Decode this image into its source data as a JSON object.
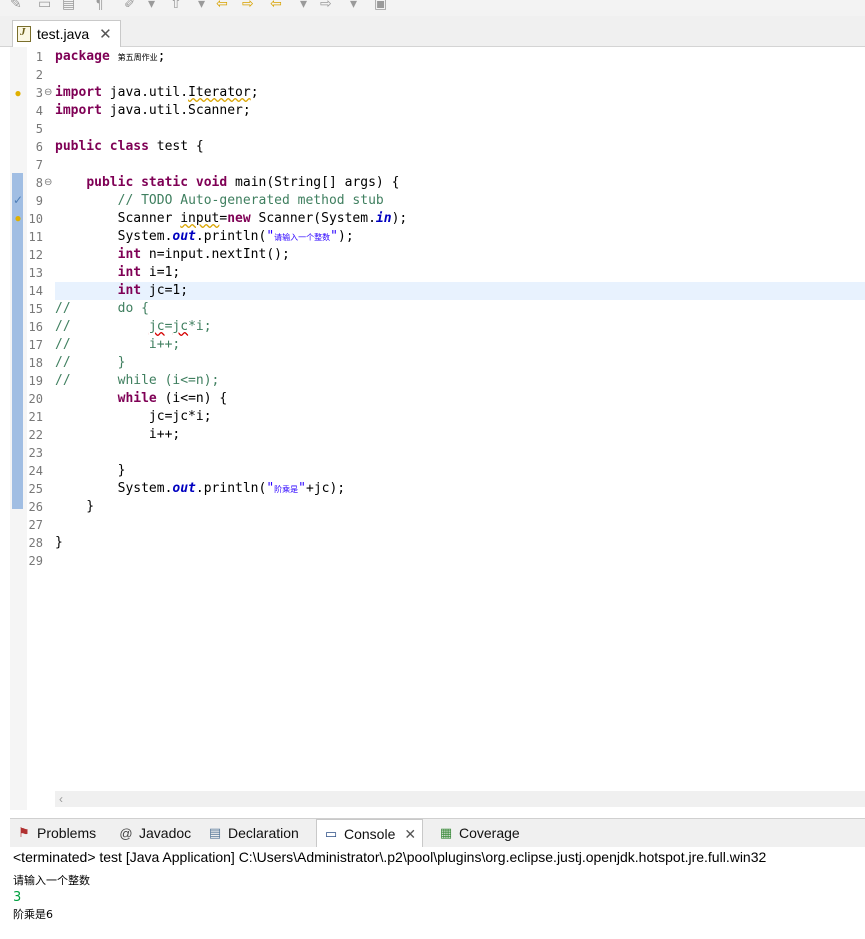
{
  "editor_tab": {
    "label": "test.java",
    "close": "✕"
  },
  "code_lines": [
    {
      "n": "1",
      "html": "<span class=\"k\">package</span> <span class=\"cjk\">第五周作业</span>;"
    },
    {
      "n": "2",
      "html": ""
    },
    {
      "n": "3",
      "html": "<span class=\"k\">import</span> java.util.<span class=\"warn\">Iterator</span>;"
    },
    {
      "n": "4",
      "html": "<span class=\"k\">import</span> java.util.Scanner;"
    },
    {
      "n": "5",
      "html": ""
    },
    {
      "n": "6",
      "html": "<span class=\"k\">public</span> <span class=\"k\">class</span> test {"
    },
    {
      "n": "7",
      "html": ""
    },
    {
      "n": "8",
      "html": "    <span class=\"k\">public</span> <span class=\"k\">static</span> <span class=\"k\">void</span> main(String[] args) {"
    },
    {
      "n": "9",
      "html": "        <span class=\"c\">// TODO Auto-generated method stub</span>"
    },
    {
      "n": "10",
      "html": "        Scanner <span class=\"warn\">input</span>=<span class=\"k\">new</span> Scanner(System.<span class=\"f\">in</span>);"
    },
    {
      "n": "11",
      "html": "        System.<span class=\"f\">out</span>.println(<span class=\"s\">\"<span class=\"cjk\">请输入一个整数</span>\"</span>);"
    },
    {
      "n": "12",
      "html": "        <span class=\"k\">int</span> n=input.nextInt();"
    },
    {
      "n": "13",
      "html": "        <span class=\"k\">int</span> i=1;"
    },
    {
      "n": "14",
      "html": "        <span class=\"k\">int</span> jc=1;"
    },
    {
      "n": "15",
      "html": "<span class=\"c\">//      do {</span>"
    },
    {
      "n": "16",
      "html": "<span class=\"c\">//          <span class=\"err\">jc</span>=<span class=\"err\">jc</span>*i;</span>"
    },
    {
      "n": "17",
      "html": "<span class=\"c\">//          i++;</span>"
    },
    {
      "n": "18",
      "html": "<span class=\"c\">//      }</span>"
    },
    {
      "n": "19",
      "html": "<span class=\"c\">//      while (i&lt;=n);</span>"
    },
    {
      "n": "20",
      "html": "        <span class=\"k\">while</span> (i&lt;=n) {"
    },
    {
      "n": "21",
      "html": "            jc=jc*i;"
    },
    {
      "n": "22",
      "html": "            i++;"
    },
    {
      "n": "23",
      "html": ""
    },
    {
      "n": "24",
      "html": "        }"
    },
    {
      "n": "25",
      "html": "        System.<span class=\"f\">out</span>.println(<span class=\"s\">\"<span class=\"cjk\">阶乘是</span>\"</span>+jc);"
    },
    {
      "n": "26",
      "html": "    }"
    },
    {
      "n": "27",
      "html": ""
    },
    {
      "n": "28",
      "html": "}"
    },
    {
      "n": "29",
      "html": ""
    }
  ],
  "panel_tabs": [
    {
      "label": "Problems",
      "icon": "problems-icon"
    },
    {
      "label": "Javadoc",
      "icon": "javadoc-icon"
    },
    {
      "label": "Declaration",
      "icon": "declaration-icon"
    },
    {
      "label": "Console",
      "icon": "console-icon",
      "close": "✕"
    },
    {
      "label": "Coverage",
      "icon": "coverage-icon"
    }
  ],
  "console": {
    "status": "<terminated> test [Java Application] C:\\Users\\Administrator\\.p2\\pool\\plugins\\org.eclipse.justj.openjdk.hotspot.jre.full.win32",
    "prompt": "请输入一个整数",
    "input": "3",
    "output": "阶乘是6"
  },
  "colors": {
    "keyword": "#7f0055",
    "comment": "#3f7f5f",
    "string": "#2a00ff",
    "field": "#0000c0",
    "current_line": "#e8f2fe"
  }
}
